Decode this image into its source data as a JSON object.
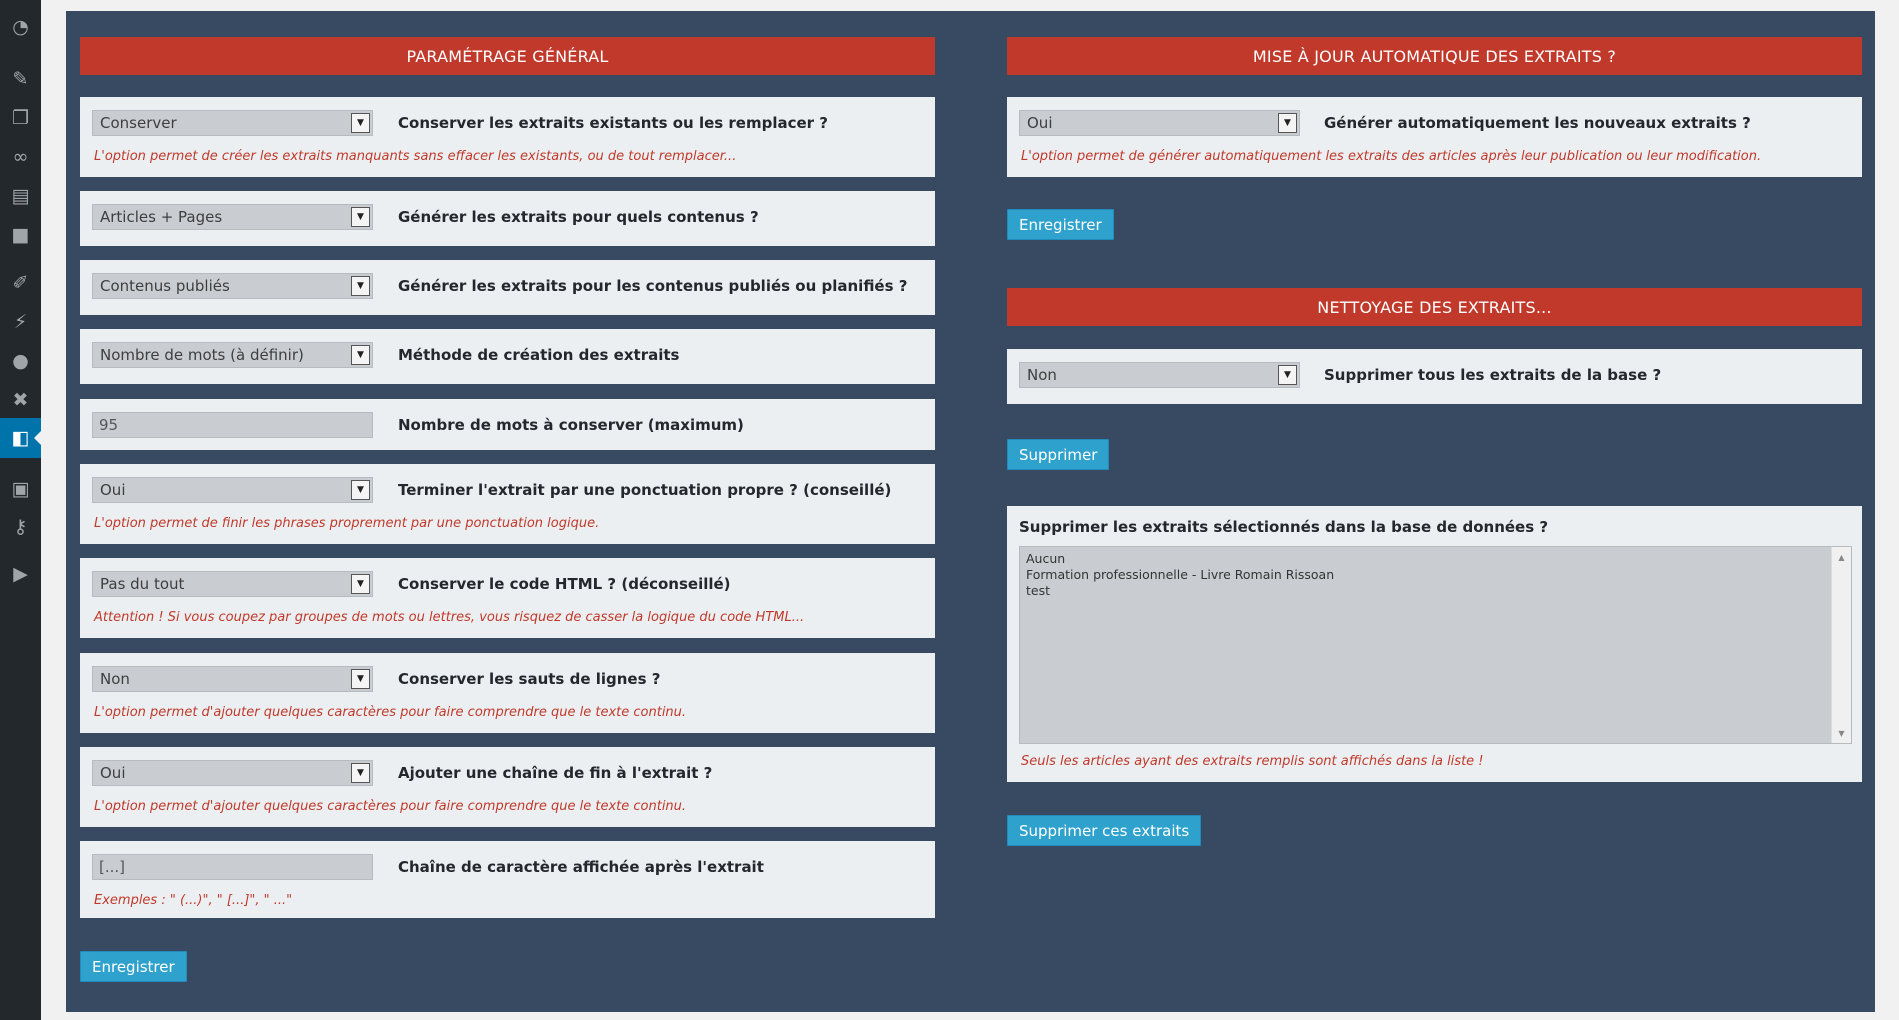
{
  "sidebar": {
    "icons": [
      "dashboard-icon",
      "pin-icon",
      "media-icon",
      "link-icon",
      "pages-icon",
      "comments-icon",
      "appearance-icon",
      "plugins-icon",
      "users-icon",
      "tools-icon",
      "active-plugin-icon",
      "database-icon",
      "key-icon",
      "play-icon"
    ]
  },
  "general": {
    "title": "PARAMÉTRAGE GÉNÉRAL",
    "rows": [
      {
        "value": "Conserver",
        "label": "Conserver les extraits existants ou les remplacer ?",
        "hint": "L'option permet de créer les extraits manquants sans effacer les existants, ou de tout remplacer..."
      },
      {
        "value": "Articles + Pages",
        "label": "Générer les extraits pour quels contenus ?"
      },
      {
        "value": "Contenus publiés",
        "label": "Générer les extraits pour les contenus publiés ou planifiés ?"
      },
      {
        "value": "Nombre de mots (à définir)",
        "label": "Méthode de création des extraits"
      },
      {
        "value": "95",
        "label": "Nombre de mots à conserver (maximum)"
      },
      {
        "value": "Oui",
        "label": "Terminer l'extrait par une ponctuation propre ? (conseillé)",
        "hint": "L'option permet de finir les phrases proprement par une ponctuation logique."
      },
      {
        "value": "Pas du tout",
        "label": "Conserver le code HTML ? (déconseillé)",
        "hint": "Attention ! Si vous coupez par groupes de mots ou lettres, vous risquez de casser la logique du code HTML..."
      },
      {
        "value": "Non",
        "label": "Conserver les sauts de lignes ?",
        "hint": "L'option permet d'ajouter quelques caractères pour faire comprendre que le texte continu."
      },
      {
        "value": "Oui",
        "label": "Ajouter une chaîne de fin à l'extrait ?",
        "hint": "L'option permet d'ajouter quelques caractères pour faire comprendre que le texte continu."
      },
      {
        "value": "[...]",
        "label": "Chaîne de caractère affichée après l'extrait",
        "hint": "Exemples : \" (...)\", \" [...]\", \" ...\""
      }
    ],
    "save_label": "Enregistrer"
  },
  "auto": {
    "title": "MISE À JOUR AUTOMATIQUE DES EXTRAITS ?",
    "value": "Oui",
    "label": "Générer automatiquement les nouveaux extraits ?",
    "hint": "L'option permet de générer automatiquement les extraits des articles après leur publication ou leur modification.",
    "save_label": "Enregistrer"
  },
  "cleanup": {
    "title": "NETTOYAGE DES EXTRAITS...",
    "value": "Non",
    "label": "Supprimer tous les extraits de la base ?",
    "delete_label": "Supprimer",
    "selected_title": "Supprimer les extraits sélectionnés dans la base de données ?",
    "options": [
      "Aucun",
      "Formation professionnelle - Livre Romain Rissoan",
      "test"
    ],
    "selected_hint": "Seuls les articles ayant des extraits remplis sont affichés dans la liste !",
    "delete_selected_label": "Supprimer ces extraits"
  }
}
